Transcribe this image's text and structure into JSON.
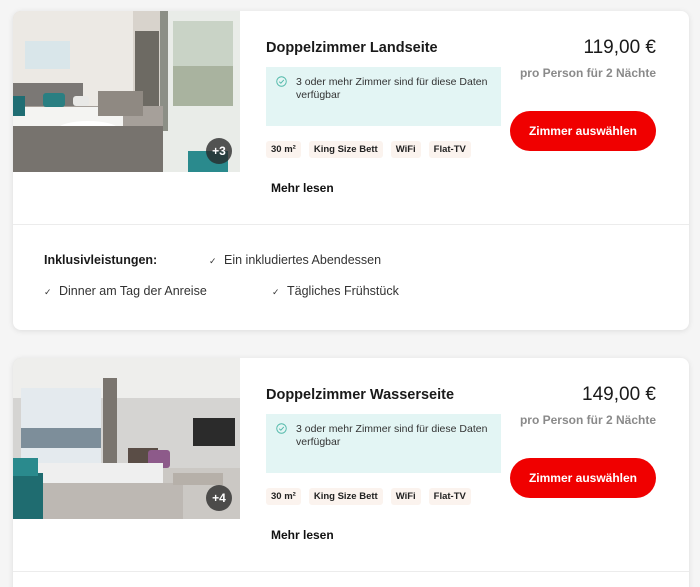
{
  "rooms": [
    {
      "title": "Doppelzimmer Landseite",
      "photo_count": "+3",
      "availability": "3 oder mehr Zimmer sind für diese Daten verfügbar",
      "tags": [
        "30 m²",
        "King Size Bett",
        "WiFi",
        "Flat-TV"
      ],
      "more_label": "Mehr lesen",
      "price": "119,00 €",
      "price_note": "pro Person für 2 Nächte",
      "button_label": "Zimmer auswählen",
      "inclusions_label": "Inklusivleistungen:",
      "inclusions": [
        "Ein inkludiertes Abendessen",
        "Dinner am Tag der Anreise",
        "Tägliches Frühstück"
      ]
    },
    {
      "title": "Doppelzimmer Wasserseite",
      "photo_count": "+4",
      "availability": "3 oder mehr Zimmer sind für diese Daten verfügbar",
      "tags": [
        "30 m²",
        "King Size Bett",
        "WiFi",
        "Flat-TV"
      ],
      "more_label": "Mehr lesen",
      "price": "149,00 €",
      "price_note": "pro Person für 2 Nächte",
      "button_label": "Zimmer auswählen"
    }
  ],
  "colors": {
    "accent_button": "#f00000",
    "availability_bg": "#e3f5f4",
    "availability_icon": "#4fb8a8",
    "tag_bg": "#fbf3ee",
    "price_note": "#8a8a8a"
  },
  "icons": {
    "availability": "check-circle-icon",
    "inclusion": "check-icon"
  }
}
